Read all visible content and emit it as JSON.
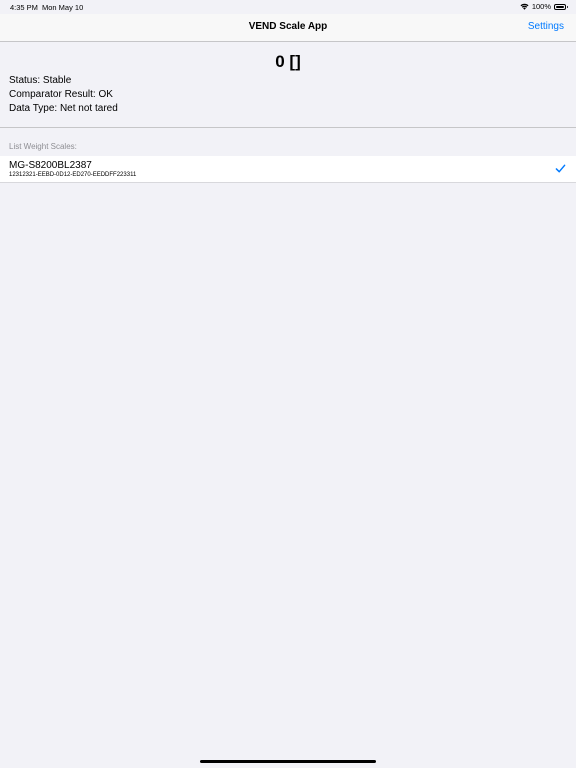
{
  "status_bar": {
    "time": "4:35 PM",
    "date": "Mon May 10",
    "battery_text": "100%",
    "battery_level": 1.0,
    "wifi_icon": "wifi-icon",
    "battery_icon": "battery-icon"
  },
  "nav": {
    "title": "VEND Scale App",
    "settings_label": "Settings"
  },
  "scale": {
    "weight": "0 []",
    "status": "Status: Stable",
    "comparator": "Comparator Result: OK",
    "data_type": "Data Type: Net not tared"
  },
  "list": {
    "header": "List Weight Scales:",
    "items": [
      {
        "name": "MG-S8200BL2387",
        "id": "12312321-EEBD-0D12-ED270-EEDDFF223311",
        "selected": true,
        "icon": "checkmark-icon"
      }
    ]
  },
  "colors": {
    "accent": "#007aff",
    "background": "#f2f2f7"
  }
}
